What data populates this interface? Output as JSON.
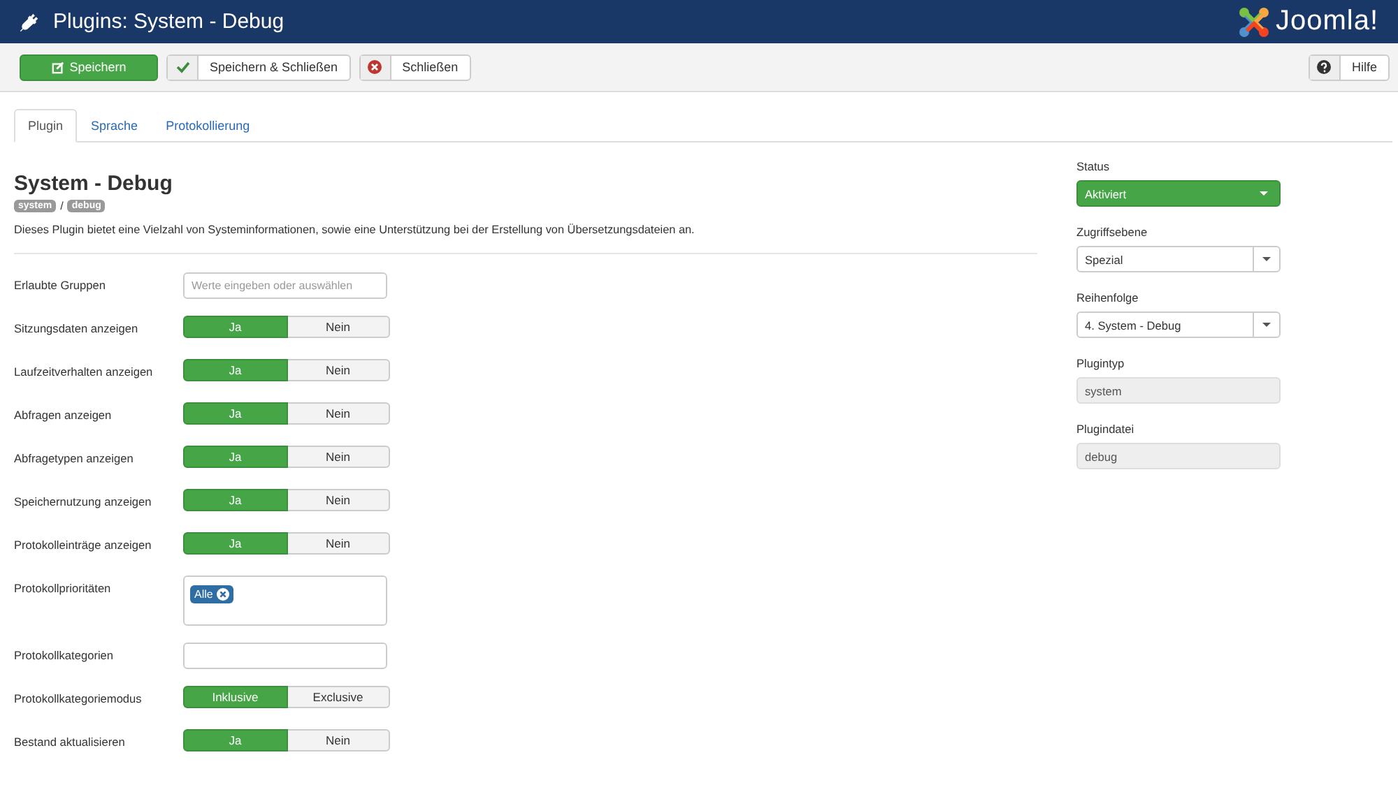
{
  "header": {
    "title": "Plugins: System - Debug",
    "logo": "Joomla!"
  },
  "toolbar": {
    "buttons": [
      {
        "label": "Speichern",
        "kind": "primary"
      },
      {
        "label": "Speichern & Schließen",
        "kind": "check"
      },
      {
        "label": "Schließen",
        "kind": "close"
      }
    ],
    "help": "Hilfe"
  },
  "tabs": [
    {
      "label": "Plugin",
      "selected": true
    },
    {
      "label": "Sprache",
      "selected": false
    },
    {
      "label": "Protokollierung",
      "selected": false
    }
  ],
  "plugin": {
    "title": "System - Debug",
    "badges": [
      "system",
      "debug"
    ],
    "separator": "/",
    "description": "Dieses Plugin bietet eine Vielzahl von Systeminformationen, sowie eine Unterstützung bei der Erstellung von Übersetzungsdateien an."
  },
  "fields": [
    {
      "label": "Erlaubte Gruppen",
      "kind": "text",
      "placeholder": "Werte eingeben oder auswählen"
    },
    {
      "label": "Sitzungsdaten anzeigen",
      "kind": "toggle",
      "options": [
        {
          "label": "Ja",
          "selected": true
        },
        {
          "label": "Nein",
          "selected": false
        }
      ]
    },
    {
      "label": "Laufzeitverhalten anzeigen",
      "kind": "toggle",
      "options": [
        {
          "label": "Ja",
          "selected": true
        },
        {
          "label": "Nein",
          "selected": false
        }
      ]
    },
    {
      "label": "Abfragen anzeigen",
      "kind": "toggle",
      "options": [
        {
          "label": "Ja",
          "selected": true
        },
        {
          "label": "Nein",
          "selected": false
        }
      ]
    },
    {
      "label": "Abfragetypen anzeigen",
      "kind": "toggle",
      "options": [
        {
          "label": "Ja",
          "selected": true
        },
        {
          "label": "Nein",
          "selected": false
        }
      ]
    },
    {
      "label": "Speichernutzung anzeigen",
      "kind": "toggle",
      "options": [
        {
          "label": "Ja",
          "selected": true
        },
        {
          "label": "Nein",
          "selected": false
        }
      ]
    },
    {
      "label": "Protokolleinträge anzeigen",
      "kind": "toggle",
      "options": [
        {
          "label": "Ja",
          "selected": true
        },
        {
          "label": "Nein",
          "selected": false
        }
      ]
    },
    {
      "label": "Protokollprioritäten",
      "kind": "tags",
      "tags": [
        "Alle"
      ]
    },
    {
      "label": "Protokollkategorien",
      "kind": "text"
    },
    {
      "label": "Protokollkategoriemodus",
      "kind": "toggle",
      "options": [
        {
          "label": "Inklusive",
          "selected": true
        },
        {
          "label": "Exclusive",
          "selected": false
        }
      ]
    },
    {
      "label": "Bestand aktualisieren",
      "kind": "toggle",
      "options": [
        {
          "label": "Ja",
          "selected": true
        },
        {
          "label": "Nein",
          "selected": false
        }
      ]
    }
  ],
  "sidebar": [
    {
      "label": "Status",
      "kind": "status",
      "value": "Aktiviert"
    },
    {
      "label": "Zugriffsebene",
      "kind": "select",
      "value": "Spezial"
    },
    {
      "label": "Reihenfolge",
      "kind": "select",
      "value": "4. System - Debug"
    },
    {
      "label": "Plugintyp",
      "kind": "readonly",
      "value": "system"
    },
    {
      "label": "Plugindatei",
      "kind": "readonly",
      "value": "debug"
    }
  ]
}
